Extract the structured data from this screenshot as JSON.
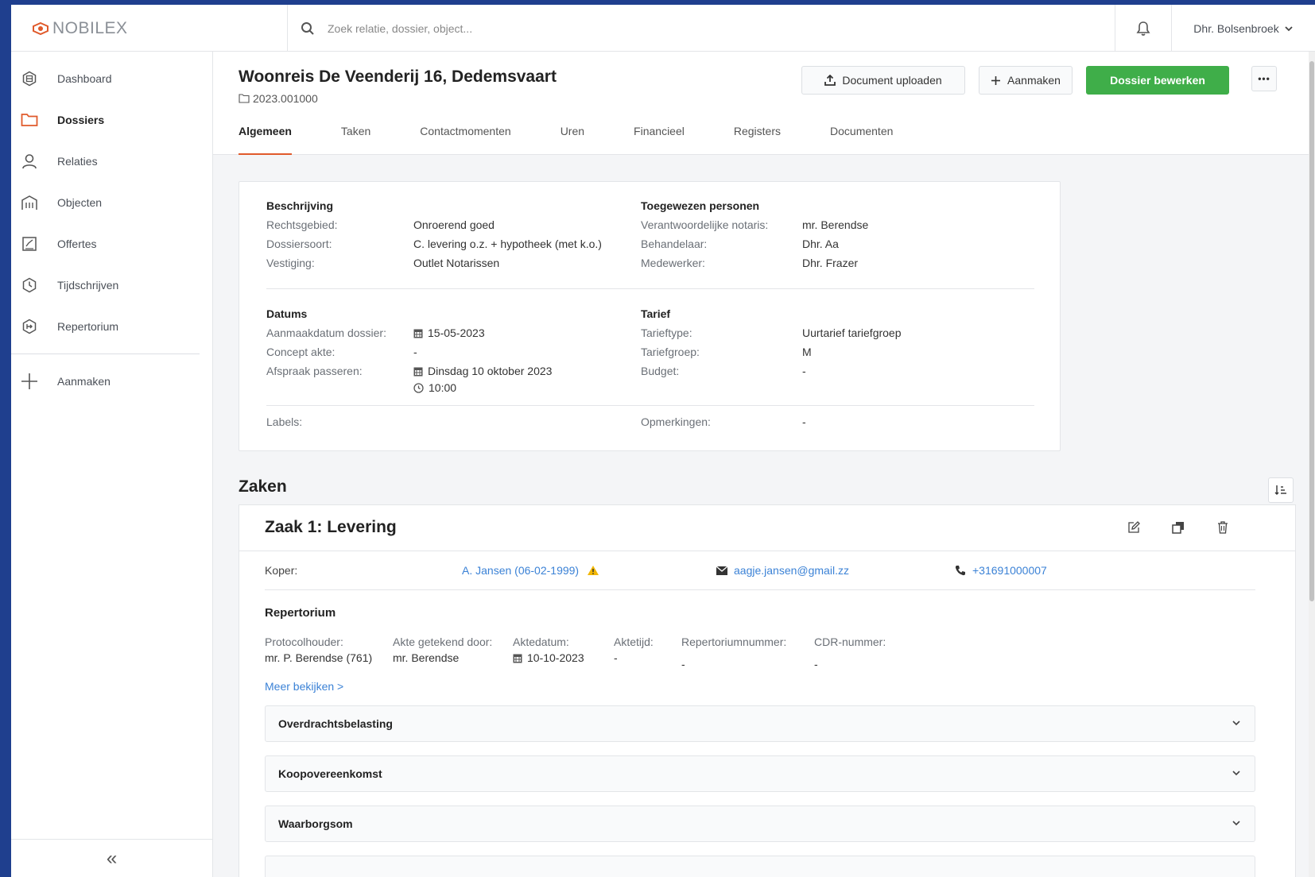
{
  "app": {
    "logo_text": "NOBILEX"
  },
  "search": {
    "placeholder": "Zoek relatie, dossier, object..."
  },
  "user": {
    "name": "Dhr. Bolsenbroek"
  },
  "sidebar": {
    "items": [
      {
        "label": "Dashboard",
        "icon": "dashboard-icon"
      },
      {
        "label": "Dossiers",
        "icon": "folder-icon",
        "active": true
      },
      {
        "label": "Relaties",
        "icon": "person-icon"
      },
      {
        "label": "Objecten",
        "icon": "building-icon"
      },
      {
        "label": "Offertes",
        "icon": "offer-icon"
      },
      {
        "label": "Tijdschrijven",
        "icon": "clock-icon"
      },
      {
        "label": "Repertorium",
        "icon": "repertorium-icon"
      }
    ],
    "create_label": "Aanmaken",
    "collapse_label": "«"
  },
  "page": {
    "title": "Woonreis De Veenderij 16, Dedemsvaart",
    "dossier_number": "2023.001000",
    "actions": {
      "upload": "Document uploaden",
      "create": "Aanmaken",
      "edit": "Dossier bewerken",
      "more": "•••"
    },
    "tabs": [
      "Algemeen",
      "Taken",
      "Contactmomenten",
      "Uren",
      "Financieel",
      "Registers",
      "Documenten"
    ],
    "active_tab": "Algemeen"
  },
  "general": {
    "beschrijving": {
      "title": "Beschrijving",
      "rechtsgebied_label": "Rechtsgebied:",
      "rechtsgebied": "Onroerend goed",
      "dossiersoort_label": "Dossiersoort:",
      "dossiersoort": "C. levering o.z. + hypotheek (met k.o.)",
      "vestiging_label": "Vestiging:",
      "vestiging": "Outlet Notarissen"
    },
    "toegewezen": {
      "title": "Toegewezen personen",
      "notaris_label": "Verantwoordelijke notaris:",
      "notaris": "mr. Berendse",
      "behandelaar_label": "Behandelaar:",
      "behandelaar": "Dhr. Aa",
      "medewerker_label": "Medewerker:",
      "medewerker": "Dhr. Frazer"
    },
    "datums": {
      "title": "Datums",
      "aanmaak_label": "Aanmaakdatum dossier:",
      "aanmaak": "15-05-2023",
      "concept_label": "Concept akte:",
      "concept": "-",
      "passeren_label": "Afspraak passeren:",
      "passeren_datum": "Dinsdag 10 oktober 2023",
      "passeren_tijd": "10:00"
    },
    "tarief": {
      "title": "Tarief",
      "type_label": "Tarieftype:",
      "type": "Uurtarief tariefgroep",
      "groep_label": "Tariefgroep:",
      "groep": "M",
      "budget_label": "Budget:",
      "budget": "-"
    },
    "labels_label": "Labels:",
    "opmerkingen_label": "Opmerkingen:",
    "opmerkingen": "-"
  },
  "zaken": {
    "title": "Zaken",
    "zaak": {
      "title": "Zaak 1: Levering",
      "koper_label": "Koper:",
      "koper": "A. Jansen (06-02-1999)",
      "email": "aagje.jansen@gmail.zz",
      "phone": "+31691000007",
      "repertorium": {
        "title": "Repertorium",
        "protocol_label": "Protocolhouder:",
        "protocol": "mr. P. Berendse (761)",
        "getekend_label": "Akte getekend door:",
        "getekend": "mr. Berendse",
        "aktedatum_label": "Aktedatum:",
        "aktedatum": "10-10-2023",
        "aktetijd_label": "Aktetijd:",
        "aktetijd": "-",
        "nummer_label": "Repertoriumnummer:",
        "nummer": "-",
        "cdr_label": "CDR-nummer:",
        "cdr": "-",
        "more_link": "Meer bekijken >"
      },
      "accordions": [
        "Overdrachtsbelasting",
        "Koopovereenkomst",
        "Waarborgsom"
      ]
    }
  },
  "colors": {
    "primary_green": "#3fae49",
    "accent_orange": "#e05a2b",
    "link_blue": "#3b82d6",
    "warning": "#f2b705"
  }
}
